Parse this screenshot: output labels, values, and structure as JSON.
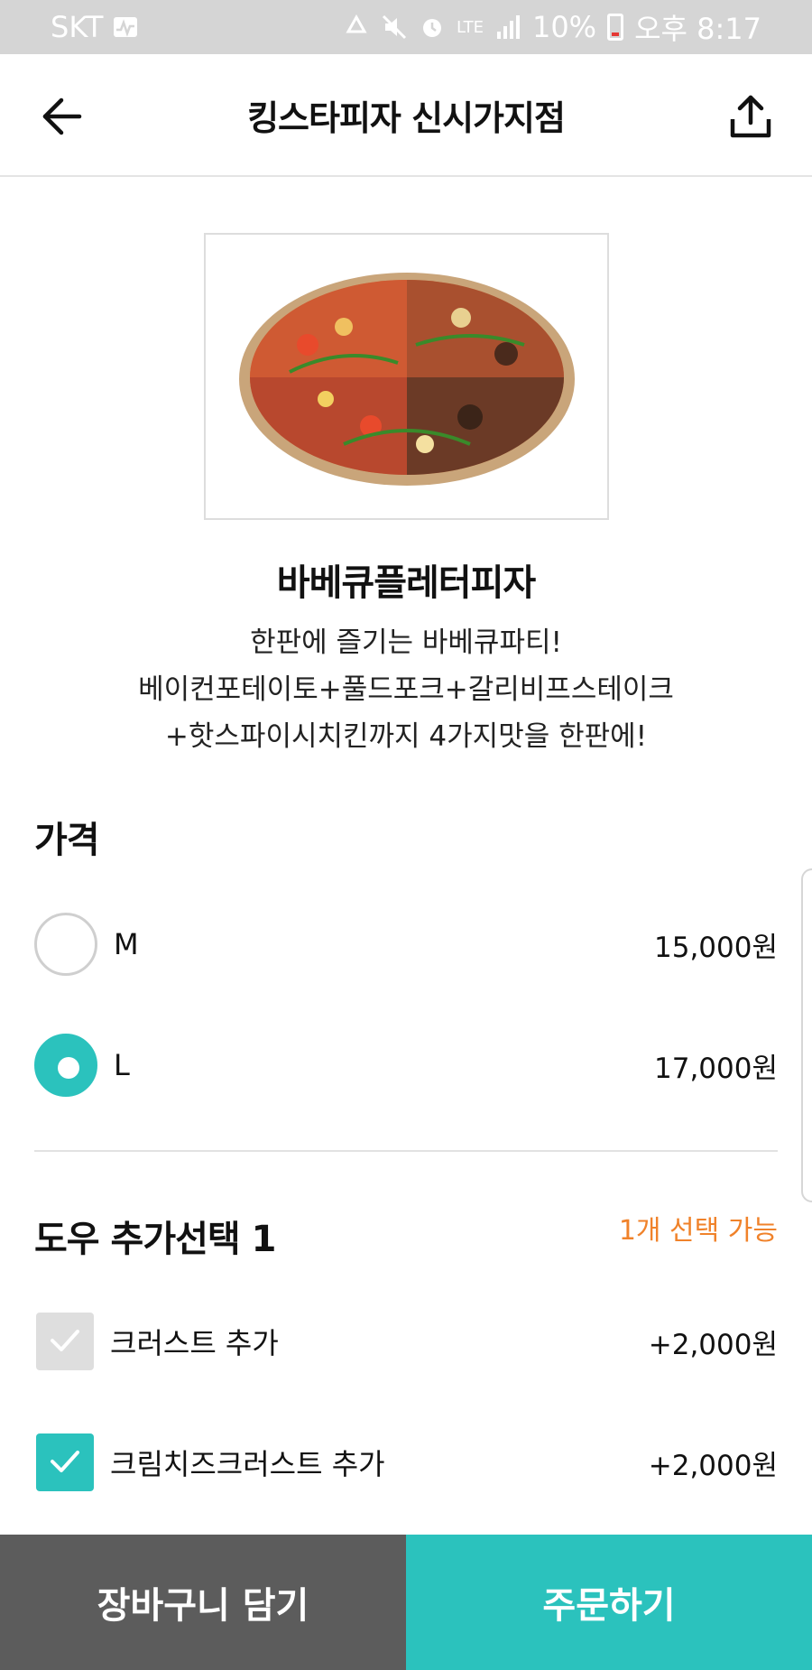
{
  "status_bar": {
    "carrier": "SKT",
    "network": "LTE",
    "battery": "10%",
    "time": "오후 8:17"
  },
  "header": {
    "title": "킹스타피자 신시가지점"
  },
  "product": {
    "name": "바베큐플레터피자",
    "description_lines": [
      "한판에 즐기는 바베큐파티!",
      "베이컨포테이토+풀드포크+갈리비프스테이크",
      "+핫스파이시치킨까지 4가지맛을 한판에!"
    ]
  },
  "price_section": {
    "title": "가격",
    "options": [
      {
        "label": "M",
        "price": "15,000원",
        "selected": false
      },
      {
        "label": "L",
        "price": "17,000원",
        "selected": true
      }
    ]
  },
  "dough_section": {
    "title": "도우 추가선택 1",
    "hint": "1개 선택 가능",
    "options": [
      {
        "label": "크러스트 추가",
        "price": "+2,000원",
        "checked": false
      },
      {
        "label": "크림치즈크러스트 추가",
        "price": "+2,000원",
        "checked": true
      }
    ]
  },
  "actions": {
    "cart": "장바구니 담기",
    "order": "주문하기"
  },
  "colors": {
    "accent": "#2bc2bd",
    "hint": "#f0822a",
    "cart_button": "#5c5c5c"
  }
}
